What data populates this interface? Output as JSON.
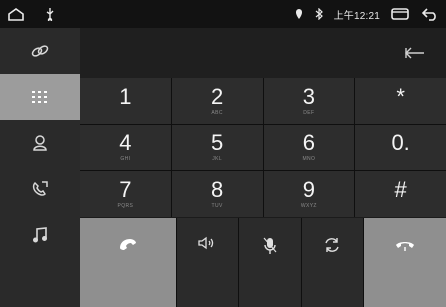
{
  "status_bar": {
    "time": "上午12:21",
    "icons": [
      "home-icon",
      "usb-icon",
      "location-icon",
      "bluetooth-icon",
      "recent-apps-icon",
      "back-icon"
    ]
  },
  "sidebar": {
    "items": [
      {
        "name": "link-icon",
        "active": false
      },
      {
        "name": "dialpad-icon",
        "active": true
      },
      {
        "name": "contacts-icon",
        "active": false
      },
      {
        "name": "call-log-icon",
        "active": false
      },
      {
        "name": "music-icon",
        "active": false
      }
    ]
  },
  "dial_input": {
    "value": "",
    "backspace_icon": "backspace-icon"
  },
  "keypad": {
    "keys": [
      {
        "digit": "1",
        "letters": ""
      },
      {
        "digit": "2",
        "letters": "ABC"
      },
      {
        "digit": "3",
        "letters": "DEF"
      },
      {
        "digit": "*",
        "letters": ""
      },
      {
        "digit": "4",
        "letters": "GHI"
      },
      {
        "digit": "5",
        "letters": "JKL"
      },
      {
        "digit": "6",
        "letters": "MNO"
      },
      {
        "digit": "0.",
        "letters": ""
      },
      {
        "digit": "7",
        "letters": "PQRS"
      },
      {
        "digit": "8",
        "letters": "TUV"
      },
      {
        "digit": "9",
        "letters": "WXYZ"
      },
      {
        "digit": "#",
        "letters": ""
      }
    ]
  },
  "actions": [
    "call-icon",
    "speaker-icon",
    "mute-mic-icon",
    "switch-audio-icon",
    "hang-up-icon"
  ],
  "colors": {
    "background": "#1b1b1b",
    "active": "#9c9c9c",
    "key": "#2d2d2d",
    "call": "#8f8f8f"
  }
}
